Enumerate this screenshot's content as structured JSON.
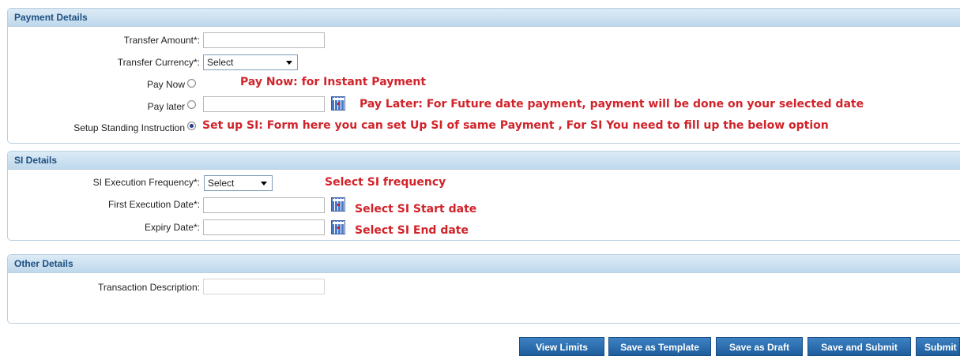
{
  "payment": {
    "header": "Payment Details",
    "transfer_amount_label": "Transfer Amount*:",
    "transfer_amount_value": "",
    "transfer_currency_label": "Transfer Currency*:",
    "transfer_currency_value": "Select",
    "pay_now_label": "Pay Now",
    "pay_now_note": "Pay Now: for Instant Payment",
    "pay_later_label": "Pay later",
    "pay_later_value": "",
    "pay_later_note": "Pay Later: For Future date payment, payment will be done on your selected date",
    "standing_label": "Setup Standing Instruction",
    "standing_note": "Set up SI: Form here you can set Up SI of same Payment , For SI You need to fill up the below option",
    "selected_option": "Setup Standing Instruction"
  },
  "si": {
    "header": "SI Details",
    "frequency_label": "SI Execution Frequency*:",
    "frequency_value": "Select",
    "frequency_note": "Select SI frequency",
    "first_date_label": "First Execution Date*:",
    "first_date_value": "",
    "first_date_note": "Select SI Start date",
    "expiry_label": "Expiry Date*:",
    "expiry_value": "",
    "expiry_note": "Select SI End date"
  },
  "other": {
    "header": "Other Details",
    "description_label": "Transaction Description:",
    "description_value": ""
  },
  "buttons": {
    "view_limits": "View Limits",
    "save_template": "Save as Template",
    "save_draft": "Save as Draft",
    "save_submit": "Save and Submit",
    "submit": "Submit"
  },
  "colors": {
    "header_text": "#1d4f80",
    "note_red": "#d1232a",
    "button_blue": "#2b6cad"
  },
  "icons": [
    "calendar-icon",
    "dropdown-arrow-icon",
    "radio-icon"
  ]
}
